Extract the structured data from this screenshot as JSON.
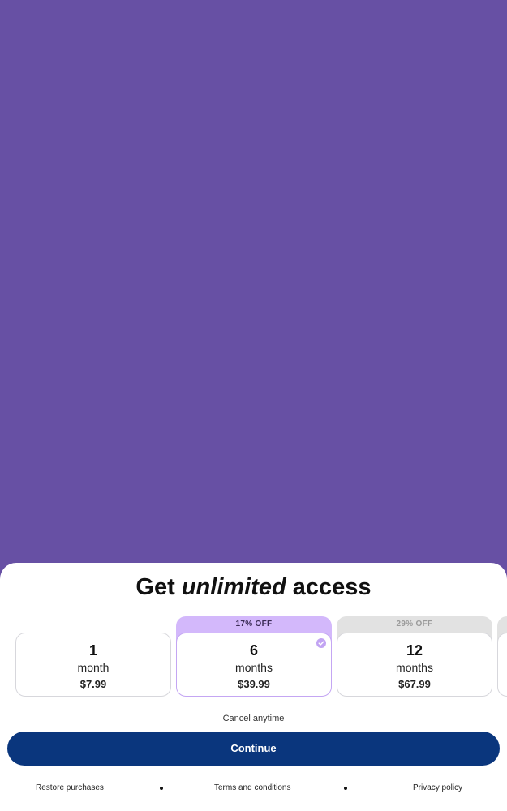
{
  "paywall": {
    "title_prefix": "Get",
    "title_emphasis": "unlimited",
    "title_suffix": "access",
    "plans": [
      {
        "number": "1",
        "unit": "month",
        "price": "$7.99",
        "badge": "",
        "selected": false
      },
      {
        "number": "6",
        "unit": "months",
        "price": "$39.99",
        "badge": "17% OFF",
        "selected": true
      },
      {
        "number": "12",
        "unit": "months",
        "price": "$67.99",
        "badge": "29% OFF",
        "selected": false
      }
    ],
    "cancel_text": "Cancel anytime",
    "continue_label": "Continue",
    "footer": {
      "restore": "Restore purchases",
      "terms": "Terms and conditions",
      "privacy": "Privacy policy"
    }
  },
  "colors": {
    "backdrop": "#6750a4",
    "primary_button": "#0a367d",
    "selected_badge": "#d3b8fb",
    "muted_badge": "#e2e2e2"
  },
  "icons": {
    "selected_plan": "check-circle-icon"
  }
}
